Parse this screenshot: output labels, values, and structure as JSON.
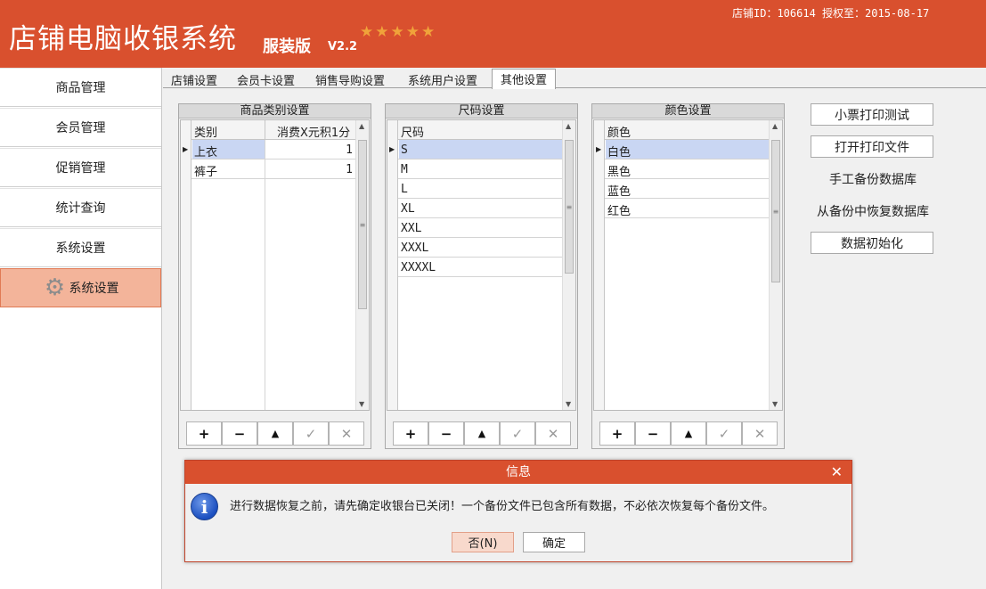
{
  "header": {
    "title": "店铺电脑收银系统",
    "edition": "服装版",
    "version": "V2.2",
    "stars": "★★★★★",
    "store_info": "店铺ID：106614 授权至：2015-08-17"
  },
  "sidebar": {
    "items": [
      {
        "label": "商品管理"
      },
      {
        "label": "会员管理"
      },
      {
        "label": "促销管理"
      },
      {
        "label": "统计查询"
      },
      {
        "label": "系统设置"
      },
      {
        "label": "系统设置",
        "active": true
      }
    ]
  },
  "tabs": [
    {
      "label": "店铺设置"
    },
    {
      "label": "会员卡设置"
    },
    {
      "label": "销售导购设置"
    },
    {
      "label": "系统用户设置"
    },
    {
      "label": "其他设置",
      "active": true
    }
  ],
  "category_panel": {
    "title": "商品类别设置",
    "columns": [
      "类别",
      "消费X元积1分"
    ],
    "rows": [
      {
        "name": "上衣",
        "points": "1"
      },
      {
        "name": "裤子",
        "points": "1"
      }
    ]
  },
  "size_panel": {
    "title": "尺码设置",
    "columns": [
      "尺码"
    ],
    "rows": [
      "S",
      "M",
      "L",
      "XL",
      "XXL",
      "XXXL",
      "XXXXL"
    ]
  },
  "color_panel": {
    "title": "颜色设置",
    "columns": [
      "颜色"
    ],
    "rows": [
      "白色",
      "黑色",
      "蓝色",
      "红色"
    ]
  },
  "grid_buttons": {
    "add": "+",
    "remove": "−",
    "up": "▲",
    "ok": "✓",
    "cancel": "✕"
  },
  "actions": {
    "receipt_test": "小票打印测试",
    "open_print_file": "打开打印文件",
    "manual_backup": "手工备份数据库",
    "restore_backup": "从备份中恢复数据库",
    "data_init": "数据初始化"
  },
  "dialog": {
    "title": "信息",
    "message": "进行数据恢复之前，请先确定收银台已关闭！一个备份文件已包含所有数据，不必依次恢复每个备份文件。",
    "no_label": "否(N)",
    "ok_label": "确定",
    "close": "✕",
    "icon": "i"
  },
  "colors": {
    "brand": "#d9502e",
    "selection": "#c9d6f3",
    "active_sidebar": "#f3b49a"
  }
}
